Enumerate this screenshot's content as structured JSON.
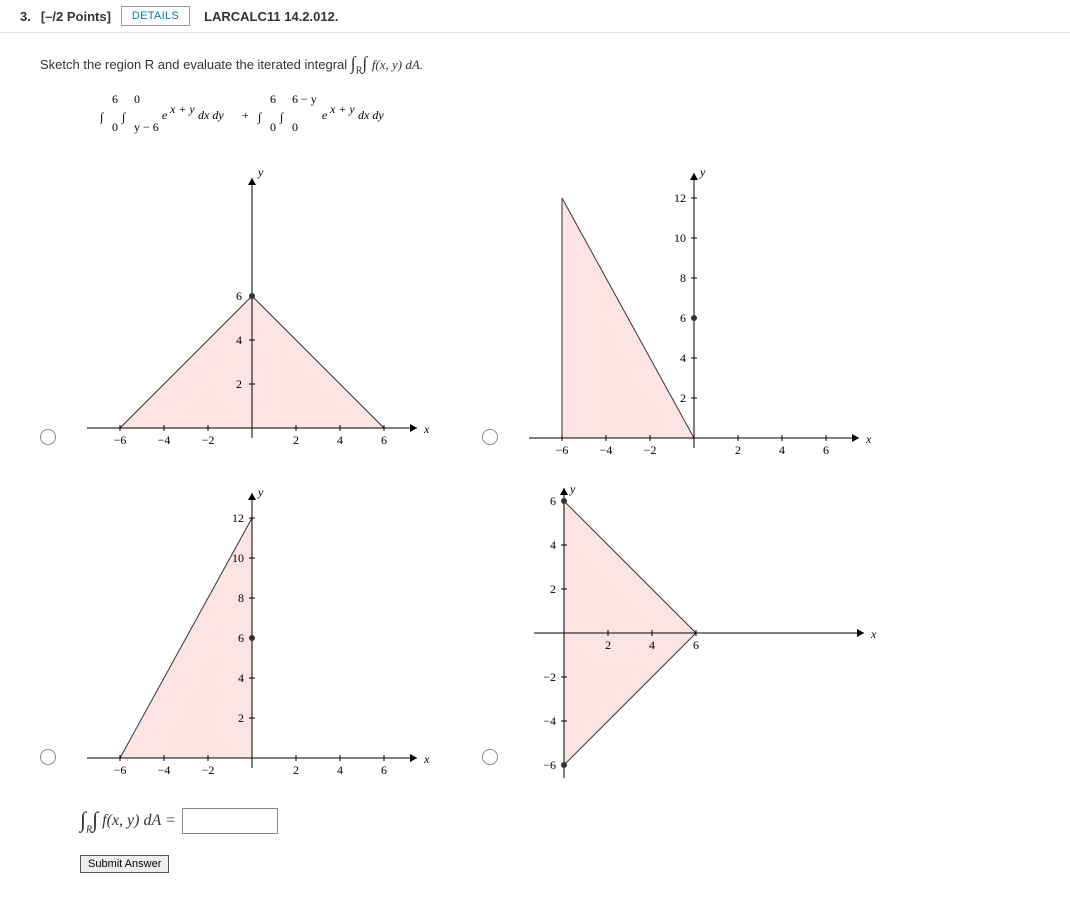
{
  "header": {
    "question_number": "3.",
    "points": "[–/2 Points]",
    "details_label": "DETAILS",
    "assignment_ref": "LARCALC11 14.2.012."
  },
  "prompt": {
    "text_before": "Sketch the region R and evaluate the iterated integral ",
    "integral_label": "f(x, y) dA."
  },
  "integral_expression": "∫₀⁶ ∫_{y−6}⁰ eˣ⁺ʸ dx dy + ∫₀⁶ ∫₀^{6−y} eˣ⁺ʸ dx dy",
  "chart_data": [
    {
      "type": "region-plot",
      "id": "A",
      "x_range": [
        -7,
        7
      ],
      "y_range": [
        -1,
        7
      ],
      "x_ticks": [
        -6,
        -4,
        -2,
        2,
        4,
        6
      ],
      "y_ticks": [
        2,
        4,
        6
      ],
      "vertices": [
        [
          -6,
          0
        ],
        [
          0,
          6
        ],
        [
          6,
          0
        ]
      ],
      "marked_point": [
        0,
        6
      ],
      "xlabel": "x",
      "ylabel": "y"
    },
    {
      "type": "region-plot",
      "id": "B",
      "x_range": [
        -7,
        7
      ],
      "y_range": [
        -1,
        13
      ],
      "x_ticks": [
        -6,
        -4,
        -2,
        2,
        4,
        6
      ],
      "y_ticks": [
        2,
        4,
        6,
        8,
        10,
        12
      ],
      "vertices": [
        [
          -6,
          0
        ],
        [
          -6,
          12
        ],
        [
          0,
          0
        ]
      ],
      "marked_point": [
        0,
        6
      ],
      "xlabel": "x",
      "ylabel": "y"
    },
    {
      "type": "region-plot",
      "id": "C",
      "x_range": [
        -7,
        7
      ],
      "y_range": [
        -1,
        13
      ],
      "x_ticks": [
        -6,
        -4,
        -2,
        2,
        4,
        6
      ],
      "y_ticks": [
        2,
        4,
        6,
        8,
        10,
        12
      ],
      "vertices": [
        [
          -6,
          0
        ],
        [
          0,
          12
        ],
        [
          0,
          0
        ]
      ],
      "marked_point": [
        0,
        6
      ],
      "xlabel": "x",
      "ylabel": "y"
    },
    {
      "type": "region-plot",
      "id": "D",
      "x_range": [
        -1,
        7
      ],
      "y_range": [
        -7,
        7
      ],
      "x_ticks": [
        2,
        4,
        6
      ],
      "y_ticks": [
        -6,
        -4,
        -2,
        2,
        4,
        6
      ],
      "vertices": [
        [
          0,
          6
        ],
        [
          6,
          0
        ],
        [
          0,
          -6
        ]
      ],
      "marked_point": [
        0,
        6
      ],
      "xlabel": "x",
      "ylabel": "y"
    }
  ],
  "answer": {
    "lhs": "∫∫_R f(x, y) dA =",
    "value": ""
  },
  "submit_label": "Submit Answer"
}
